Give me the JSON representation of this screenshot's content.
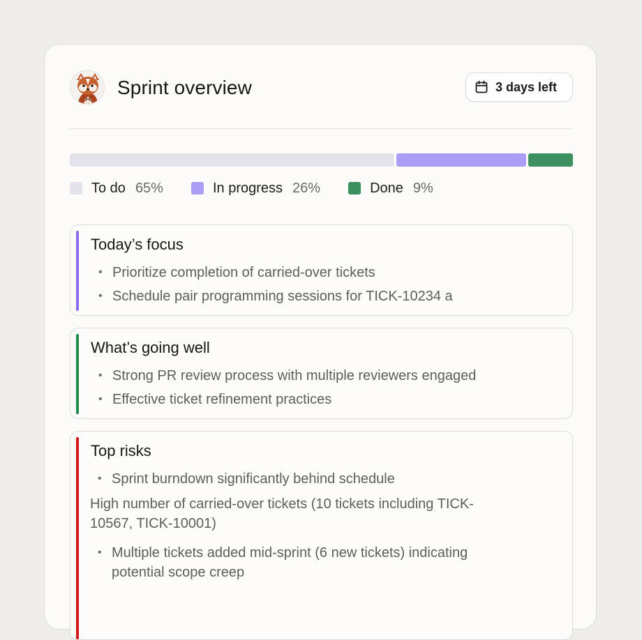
{
  "header": {
    "title": "Sprint overview",
    "days_left": "3 days left"
  },
  "progress": {
    "segments": [
      {
        "key": "todo",
        "label": "To do",
        "percent": 65,
        "percent_label": "65%",
        "color": "#e4e2ea"
      },
      {
        "key": "in_progress",
        "label": "In progress",
        "percent": 26,
        "percent_label": "26%",
        "color": "#ab9df5"
      },
      {
        "key": "done",
        "label": "Done",
        "percent": 9,
        "percent_label": "9%",
        "color": "#3d8f5f"
      }
    ]
  },
  "sections": {
    "focus": {
      "title": "Today’s focus",
      "accent": "#8b6df0",
      "bullets": [
        "Prioritize completion of carried-over tickets",
        "Schedule pair programming sessions for TICK-10234 a"
      ]
    },
    "well": {
      "title": "What’s going well",
      "accent": "#1e8a4c",
      "bullets": [
        "Strong PR review process with multiple reviewers engaged",
        "Effective ticket refinement practices"
      ]
    },
    "risks": {
      "title": "Top risks",
      "accent": "#d4161b",
      "bullet_1": "Sprint burndown significantly behind schedule",
      "paragraph": "High number of carried-over tickets (10 tickets including TICK-10567, TICK-10001)",
      "bullet_2": "Multiple tickets added mid-sprint (6 new tickets) indicating potential scope creep"
    }
  },
  "icons": {
    "avatar": "red-panda-avatar-icon",
    "days": "calendar-icon",
    "bullet": "bullet-dot-icon"
  }
}
